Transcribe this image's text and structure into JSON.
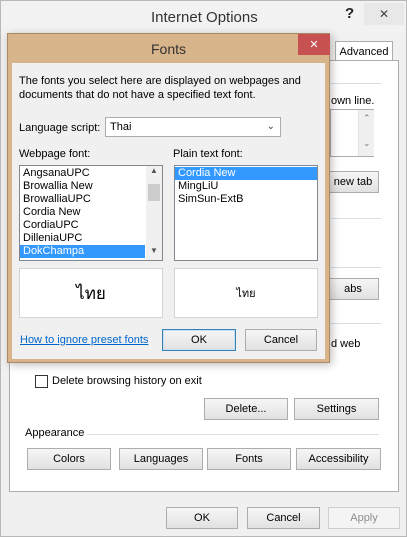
{
  "outer": {
    "title": "Internet Options",
    "help_label": "?",
    "close_label": "✕",
    "tab_advanced": "Advanced",
    "partial_text_1": "own line.",
    "scroll_up": "⌃",
    "scroll_down": "⌄",
    "new_tab_btn": "new tab",
    "tabs_btn": "abs",
    "partial_text_2": "d web",
    "delete_history_label": "Delete browsing history on exit",
    "delete_btn": "Delete...",
    "settings_btn": "Settings",
    "appearance_label": "Appearance",
    "colors_btn": "Colors",
    "languages_btn": "Languages",
    "fonts_btn": "Fonts",
    "accessibility_btn": "Accessibility",
    "ok_btn": "OK",
    "cancel_btn": "Cancel",
    "apply_btn": "Apply"
  },
  "fonts_dialog": {
    "title": "Fonts",
    "close_label": "✕",
    "description": "The fonts you select here are displayed on webpages and documents that do not have a specified text font.",
    "language_script_label": "Language script:",
    "language_script_value": "Thai",
    "webpage_font_label": "Webpage font:",
    "plain_text_font_label": "Plain text font:",
    "webpage_fonts": [
      "AngsanaUPC",
      "Browallia New",
      "BrowalliaUPC",
      "Cordia New",
      "CordiaUPC",
      "DilleniaUPC",
      "DokChampa"
    ],
    "webpage_selected": "DokChampa",
    "plain_text_fonts": [
      "Cordia New",
      "MingLiU",
      "SimSun-ExtB"
    ],
    "plain_selected": "Cordia New",
    "preview_webpage": "ไทย",
    "preview_plain": "ไทย",
    "ignore_link": "How to ignore preset fonts",
    "ok_btn": "OK",
    "cancel_btn": "Cancel"
  },
  "colors": {
    "fonts_titlebar": "#d7b48a",
    "fonts_close": "#c75050",
    "selection": "#3399ff",
    "link": "#0066cc"
  }
}
